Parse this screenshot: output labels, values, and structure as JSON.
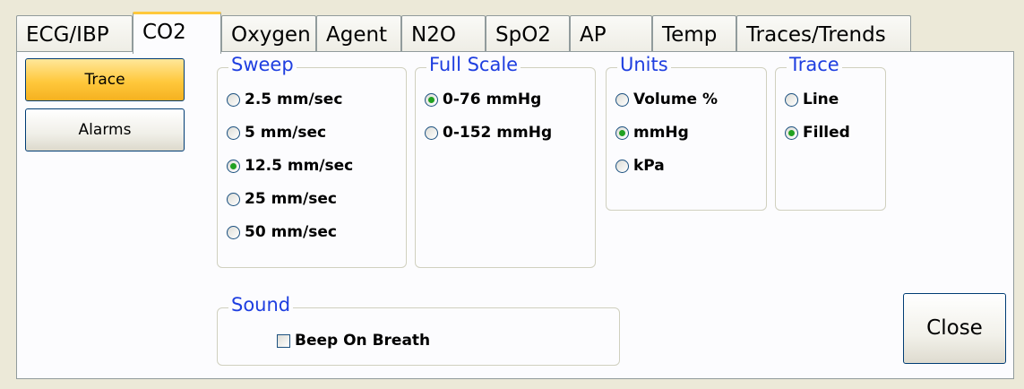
{
  "tabs": [
    {
      "label": "ECG/IBP",
      "active": false
    },
    {
      "label": "CO2",
      "active": true
    },
    {
      "label": "Oxygen",
      "active": false
    },
    {
      "label": "Agent",
      "active": false
    },
    {
      "label": "N2O",
      "active": false
    },
    {
      "label": "SpO2",
      "active": false
    },
    {
      "label": "AP",
      "active": false
    },
    {
      "label": "Temp",
      "active": false
    },
    {
      "label": "Traces/Trends",
      "active": false
    }
  ],
  "side_buttons": {
    "trace": "Trace",
    "alarms": "Alarms",
    "selected": "Trace"
  },
  "close_label": "Close",
  "sweep": {
    "title": "Sweep",
    "options": [
      "2.5 mm/sec",
      "5 mm/sec",
      "12.5 mm/sec",
      "25 mm/sec",
      "50 mm/sec"
    ],
    "selected": "12.5 mm/sec"
  },
  "full_scale": {
    "title": "Full Scale",
    "options": [
      "0-76 mmHg",
      "0-152 mmHg"
    ],
    "selected": "0-76 mmHg"
  },
  "units": {
    "title": "Units",
    "options": [
      "Volume %",
      "mmHg",
      "kPa"
    ],
    "selected": "mmHg"
  },
  "trace": {
    "title": "Trace",
    "options": [
      "Line",
      "Filled"
    ],
    "selected": "Filled"
  },
  "sound": {
    "title": "Sound",
    "beep_label": "Beep On Breath",
    "beep_checked": false
  },
  "colors": {
    "accent": "#ffc83c",
    "legend": "#1e3ee0",
    "radio_dot": "#21a121",
    "background": "#ece9d8"
  }
}
